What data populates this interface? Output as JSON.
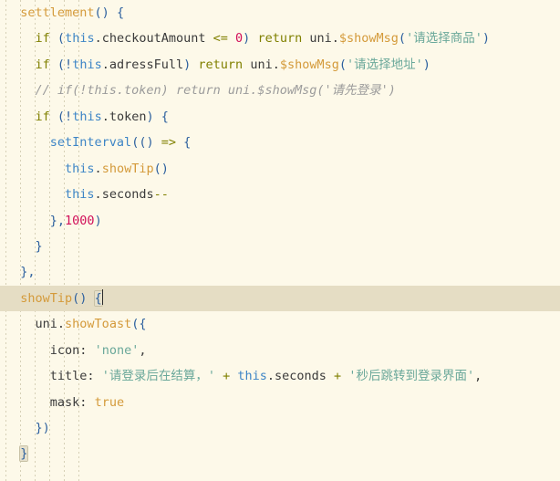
{
  "editor": {
    "background_color": "#fdf9e9",
    "current_line_color": "#e5ddc4",
    "brace_match_color": "#e6e0cb",
    "font_size_px": 13.5,
    "line_height_px": 28.45,
    "indent_guide_color": "#cfc9ad",
    "indent_guide_xs": [
      6,
      22,
      38,
      54,
      70,
      86
    ],
    "current_line_index": 11,
    "caret_line_index": 11
  },
  "colors": {
    "keyword": "#808000",
    "identifier_blue": "#3d85c6",
    "method_gold": "#d49a3a",
    "string_teal": "#6aa89a",
    "number_pink": "#d1105a",
    "comment_gray": "#9b9b9b",
    "brace_blue": "#2b5f9e",
    "text": "#3a3a3a"
  },
  "code": {
    "language": "javascript",
    "lines": [
      "  settlement() {",
      "    if (this.checkoutAmount <= 0) return uni.$showMsg('请选择商品')",
      "    if (!this.adressFull) return uni.$showMsg('请选择地址')",
      "    // if(!this.token) return uni.$showMsg('请先登录')",
      "    if (!this.token) {",
      "      setInterval(() => {",
      "        this.showTip()",
      "        this.seconds--",
      "      },1000)",
      "    }",
      "  },",
      "  showTip() {",
      "    uni.showToast({",
      "      icon: 'none',",
      "      title: '请登录后在结算，' + this.seconds + '秒后跳转到登录界面',",
      "      mask: true",
      "    })",
      "  }"
    ],
    "tokens": {
      "l0_name": "settlement",
      "l0_parens": "()",
      "l0_brace": "{",
      "l1_if": "if",
      "l1_open": "(",
      "l1_this": "this",
      "l1_dot_prop": ".checkoutAmount",
      "l1_op": " <= ",
      "l1_num": "0",
      "l1_close": ")",
      "l1_return": "return",
      "l1_uni": "uni",
      "l1_dot": ".",
      "l1_method": "$showMsg",
      "l1_lp": "(",
      "l1_str": "'请选择商品'",
      "l1_rp": ")",
      "l2_if": "if",
      "l2_open": "(!",
      "l2_this": "this",
      "l2_prop": ".adressFull",
      "l2_close": ")",
      "l2_return": "return",
      "l2_uni": "uni",
      "l2_dot": ".",
      "l2_method": "$showMsg",
      "l2_lp": "(",
      "l2_str": "'请选择地址'",
      "l2_rp": ")",
      "l3_comment": "// if(!this.token) return uni.$showMsg('请先登录')",
      "l4_if": "if",
      "l4_open": "(!",
      "l4_this": "this",
      "l4_prop": ".token",
      "l4_close": ")",
      "l4_brace": "{",
      "l5_fn": "setInterval",
      "l5_args": "(()",
      "l5_arrow": " => ",
      "l5_brace": "{",
      "l6_this": "this",
      "l6_dot": ".",
      "l6_method": "showTip",
      "l6_parens": "()",
      "l7_this": "this",
      "l7_dot": ".",
      "l7_prop": "seconds",
      "l7_dec": "--",
      "l8_brace": "},",
      "l8_num": "1000",
      "l8_close": ")",
      "l9_brace": "}",
      "l10_brace": "},",
      "l11_name": "showTip",
      "l11_parens": "()",
      "l11_brace": "{",
      "l12_uni": "uni",
      "l12_dot": ".",
      "l12_method": "showToast",
      "l12_open": "({",
      "l13_key": "icon:",
      "l13_str": "'none'",
      "l13_comma": ",",
      "l14_key": "title:",
      "l14_str1": "'请登录后在结算，'",
      "l14_plus1": " + ",
      "l14_this": "this",
      "l14_dot": ".",
      "l14_prop": "seconds",
      "l14_plus2": " + ",
      "l14_str2": "'秒后跳转到登录界面'",
      "l14_comma": ",",
      "l15_key": "mask:",
      "l15_bool": "true",
      "l16_close": "})",
      "l17_close": "}"
    }
  }
}
